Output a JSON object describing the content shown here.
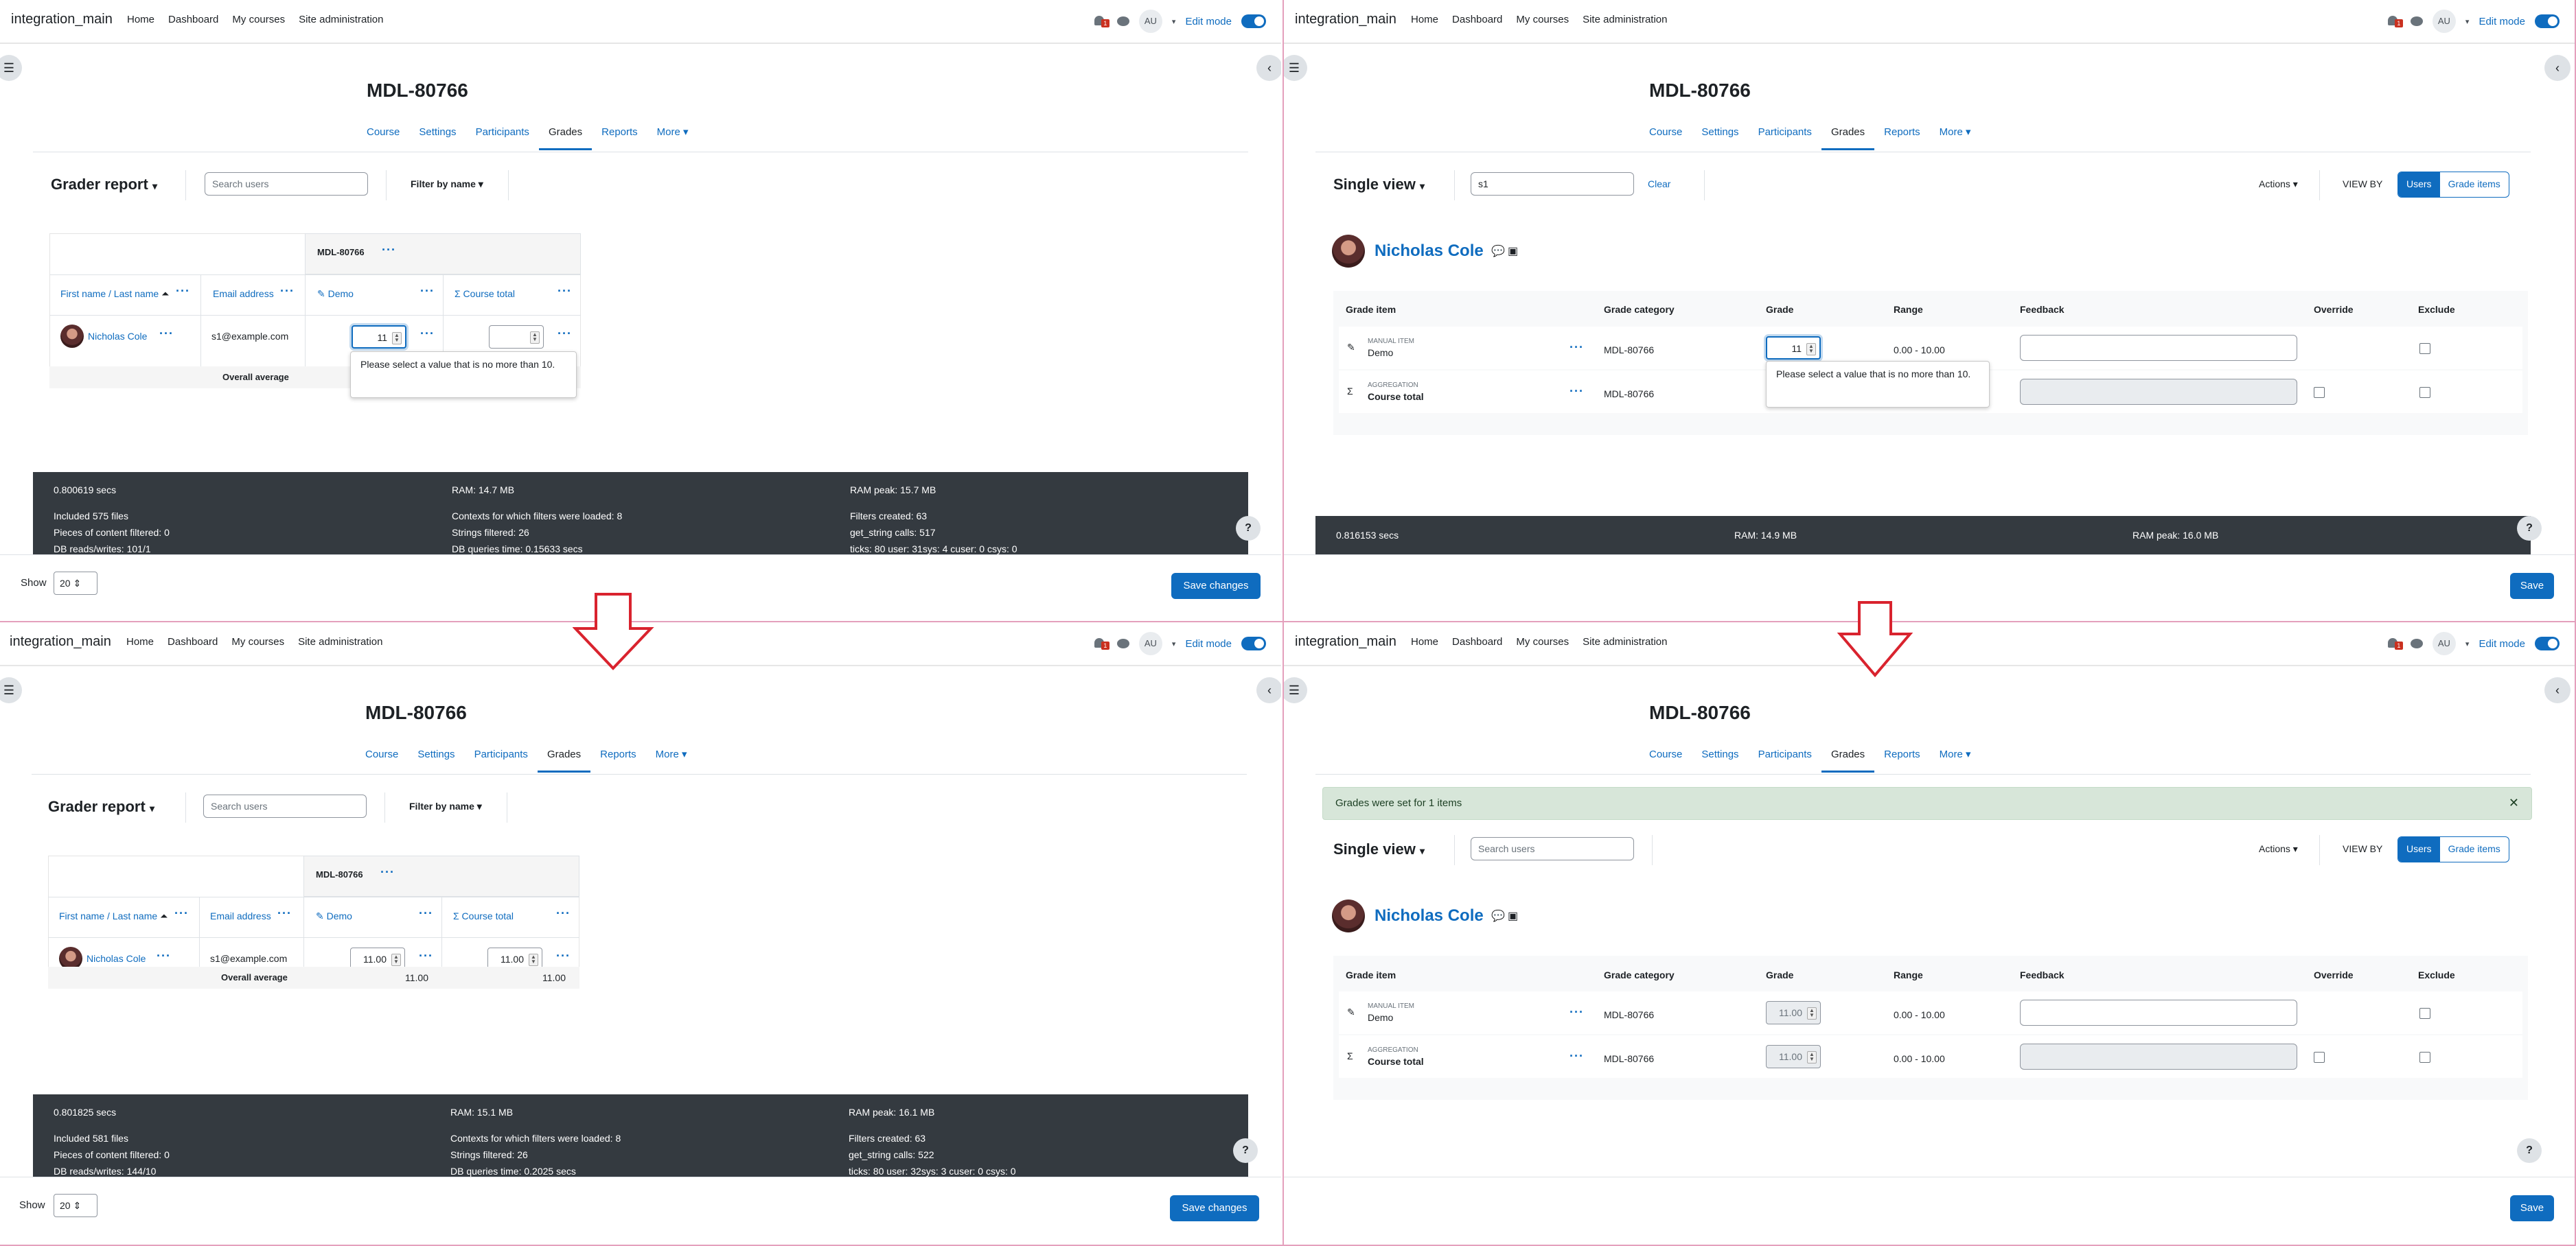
{
  "app": {
    "brand": "integration_main",
    "nav": [
      "Home",
      "Dashboard",
      "My courses",
      "Site administration"
    ],
    "user_initials": "AU",
    "edit_mode_label": "Edit mode",
    "notification_count": "1"
  },
  "course": {
    "title": "MDL-80766",
    "tabs": [
      "Course",
      "Settings",
      "Participants",
      "Grades",
      "Reports",
      "More"
    ],
    "active_tab": "Grades"
  },
  "grader": {
    "title": "Grader report",
    "search_placeholder": "Search users",
    "filter_label": "Filter by name",
    "category_header": "MDL-80766",
    "col_name": "First name / Last name",
    "col_name_first": "First name",
    "col_name_sep": " / ",
    "col_name_last": "Last name",
    "col_email": "Email address",
    "col_demo": "Demo",
    "col_total": "Course total",
    "student_name": "Nicholas Cole",
    "student_email": "s1@example.com",
    "overall_label": "Overall average",
    "tl_demo_value": "11",
    "tl_total_value": "",
    "bl_demo_value": "11.00",
    "bl_total_value": "11.00",
    "bl_avg_demo": "11.00",
    "bl_avg_total": "11.00",
    "tooltip": "Please select a value that is no more than 10.",
    "show_label": "Show",
    "show_value": "20",
    "save_label": "Save changes"
  },
  "perf_tl": {
    "secs": "0.800619 secs",
    "ram": "RAM: 14.7 MB",
    "ram_peak": "RAM peak: 15.7 MB",
    "files": "Included 575 files",
    "filtered": "Pieces of content filtered: 0",
    "db": "DB reads/writes: 101/1",
    "contexts": "Contexts for which filters were loaded: 8",
    "strings": "Strings filtered: 26",
    "dbtime": "DB queries time: 0.15633 secs",
    "filters": "Filters created: 63",
    "getstring": "get_string calls: 517",
    "ticks": "ticks: 80 user: 31sys: 4 cuser: 0 csys: 0"
  },
  "perf_bl": {
    "secs": "0.801825 secs",
    "ram": "RAM: 15.1 MB",
    "ram_peak": "RAM peak: 16.1 MB",
    "files": "Included 581 files",
    "filtered": "Pieces of content filtered: 0",
    "db": "DB reads/writes: 144/10",
    "contexts": "Contexts for which filters were loaded: 8",
    "strings": "Strings filtered: 26",
    "dbtime": "DB queries time: 0.2025 secs",
    "filters": "Filters created: 63",
    "getstring": "get_string calls: 522",
    "ticks": "ticks: 80 user: 32sys: 3 cuser: 0 csys: 0"
  },
  "perf_tr": {
    "secs": "0.816153 secs",
    "ram": "RAM: 14.9 MB",
    "ram_peak": "RAM peak: 16.0 MB"
  },
  "single": {
    "title": "Single view",
    "search_value": "s1",
    "search_placeholder": "Search users",
    "clear_label": "Clear",
    "actions_label": "Actions",
    "view_by": "VIEW BY",
    "seg_users": "Users",
    "seg_items": "Grade items",
    "student_name": "Nicholas Cole",
    "headers": [
      "Grade item",
      "Grade category",
      "Grade",
      "Range",
      "Feedback",
      "Override",
      "Exclude"
    ],
    "row1_type": "MANUAL ITEM",
    "row1_name": "Demo",
    "row2_type": "AGGREGATION",
    "row2_name": "Course total",
    "category": "MDL-80766",
    "range": "0.00 - 10.00",
    "tr_grade1": "11",
    "br_grade1": "11.00",
    "br_grade2": "11.00",
    "tooltip": "Please select a value that is no more than 10.",
    "alert": "Grades were set for 1 items",
    "save_label": "Save"
  },
  "colors": {
    "primary": "#0f6cbf",
    "dark": "#343a40",
    "success_bg": "#d7e6d9",
    "arrow": "#d9232e",
    "divider": "#e4a0bc"
  }
}
